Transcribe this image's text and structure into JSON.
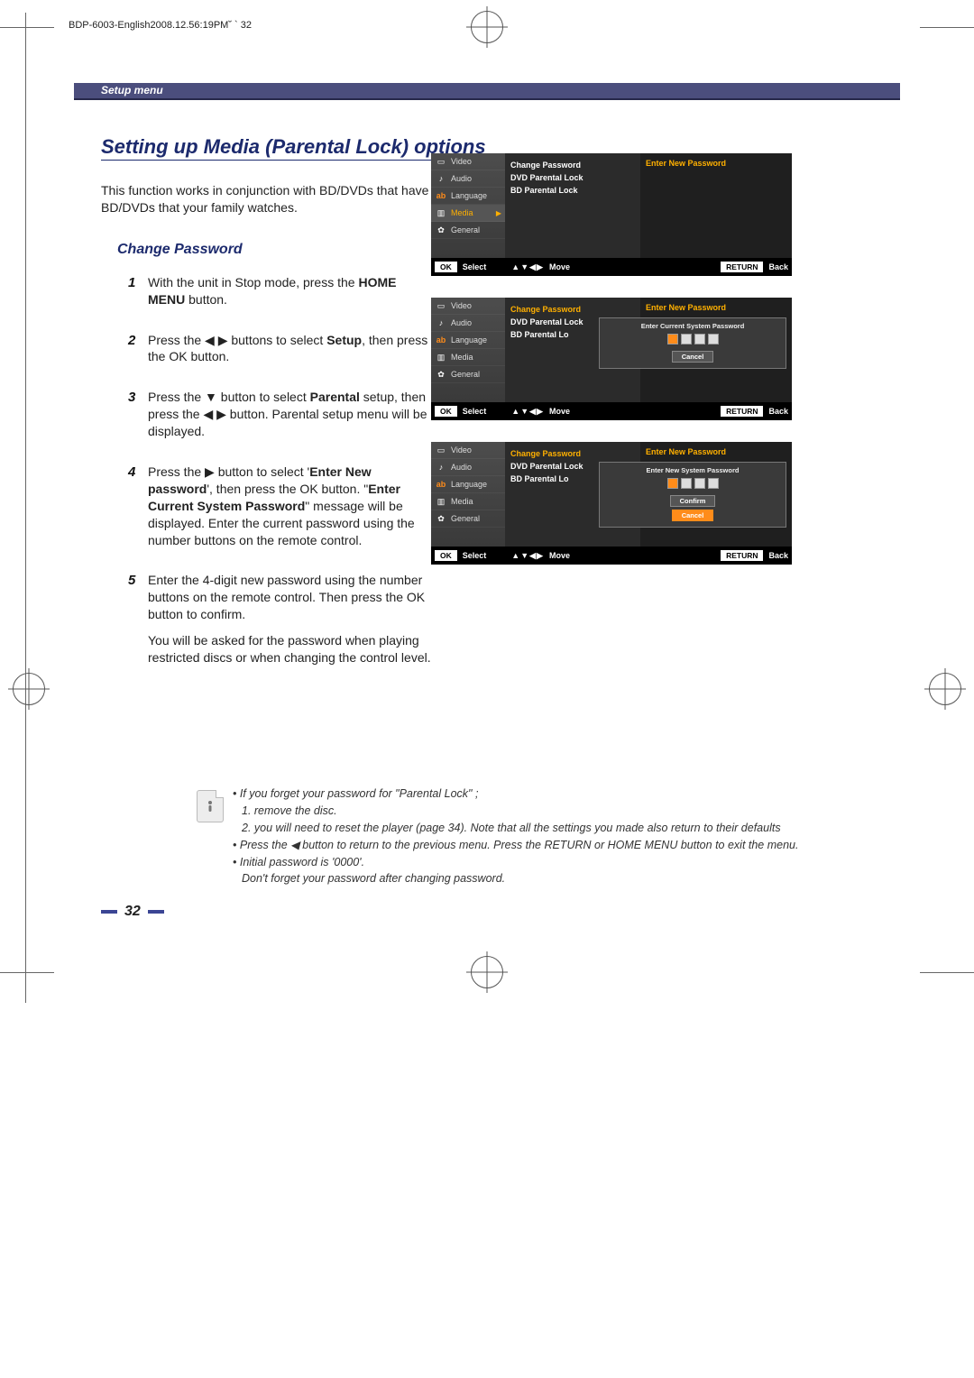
{
  "doc_id_line": "BDP-6003-English2008.12.56:19PM˘    `    32",
  "header": {
    "section": "Setup menu"
  },
  "title": "Setting up Media (Parental Lock) options",
  "intro": "This function works in conjunction with BD/DVDs that have been assigned a rating which helps you control the types of BD/DVDs that your family watches.",
  "subsection": "Change Password",
  "steps": {
    "s1": {
      "num": "1",
      "pre": "With the unit in Stop mode, press the ",
      "b1": "HOME MENU",
      "post": " button."
    },
    "s2": {
      "num": "2",
      "pre": "Press the ",
      "arrows": "◀ ▶",
      "mid": " buttons to select ",
      "b1": "Setup",
      "post": ", then press the OK button."
    },
    "s3": {
      "num": "3",
      "pre": "Press the ",
      "arrow": "▼",
      "mid": " button to select ",
      "b1": "Parental",
      "mid2": " setup, then press the ",
      "arrows2": "◀ ▶",
      "post": " button. Parental setup menu will be displayed."
    },
    "s4": {
      "num": "4",
      "pre": "Press the ",
      "arrow": "▶",
      "mid": " button to select '",
      "b1": "Enter New password",
      "mid2": "', then press the OK button. \"",
      "b2": "Enter Current System Password",
      "post": "\" message will be displayed. Enter the current password using the number buttons on the remote control."
    },
    "s5": {
      "num": "5",
      "l1": "Enter the 4-digit new password using the number buttons on the remote control.  Then press the OK button to confirm.",
      "l2": "You will be asked for the password when playing restricted discs or when changing the control level."
    }
  },
  "notes": {
    "n1": "If you forget your password for \"Parental Lock\" ;",
    "n1a": "1. remove the disc.",
    "n1b": "2. you will need to reset the player (page 34). Note that all the settings you made also return to their defaults",
    "n2a": "Press the ",
    "n2arrow": "◀",
    "n2b": " button to return to the previous menu. Press the RETURN or HOME MENU button to exit the menu.",
    "n3a": "Initial password is '0000'.",
    "n3b": "Don't forget your password after changing password."
  },
  "page_number": "32",
  "osd": {
    "side": {
      "video": "Video",
      "audio": "Audio",
      "language": "Language",
      "media": "Media",
      "general": "General"
    },
    "mid": {
      "change_pw": "Change Password",
      "dvd_lock": "DVD Parental Lock",
      "bd_lock": "BD Parental Lock",
      "bd_lock_cut": "BD Parental Lo"
    },
    "right_title": "Enter New Password",
    "dlg1_title": "Enter Current System Password",
    "dlg2_title": "Enter New System Password",
    "cancel": "Cancel",
    "confirm": "Confirm",
    "ctrl": {
      "ok": "OK",
      "select": "Select",
      "move": "Move",
      "return": "RETURN",
      "back": "Back",
      "arrows": "▲▼◀▶"
    }
  }
}
